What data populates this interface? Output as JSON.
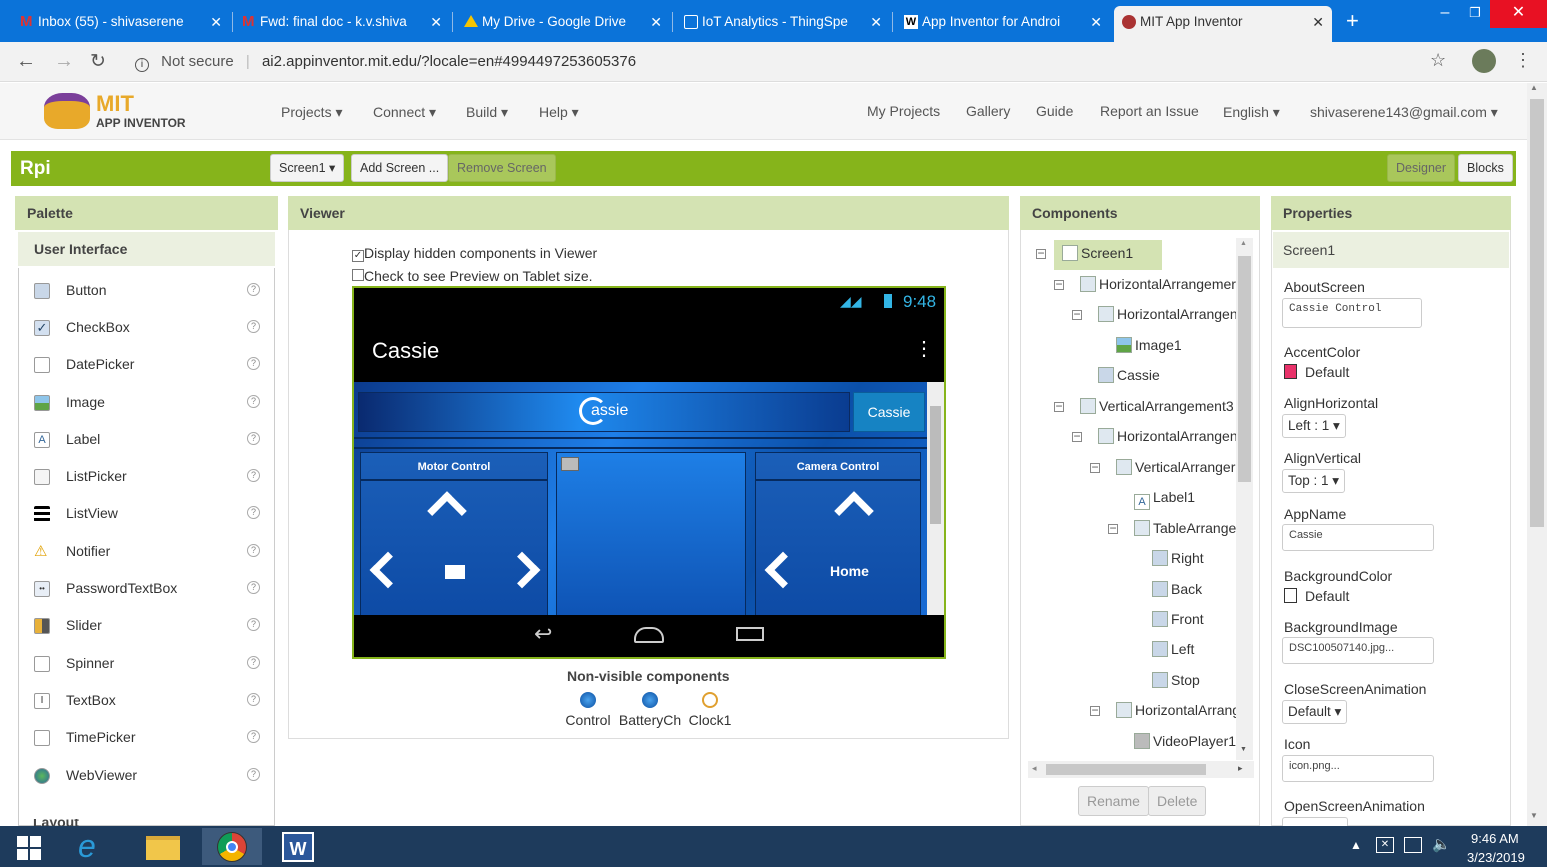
{
  "browser": {
    "tabs": [
      {
        "title": "Inbox (55) - shivaserene",
        "icon": "gmail-icon"
      },
      {
        "title": "Fwd: final doc - k.v.shiva",
        "icon": "gmail-icon"
      },
      {
        "title": "My Drive - Google Drive",
        "icon": "drive-icon"
      },
      {
        "title": "IoT Analytics - ThingSpe",
        "icon": "thingspeak-icon"
      },
      {
        "title": "App Inventor for Androi",
        "icon": "wikipedia-icon"
      },
      {
        "title": "MIT App Inventor",
        "icon": "appinventor-icon"
      }
    ],
    "security": "Not secure",
    "url": "ai2.appinventor.mit.edu/?locale=en#4994497253605376"
  },
  "app": {
    "logo_mit": "MIT",
    "logo_sub": "APP INVENTOR",
    "menus": [
      "Projects ▾",
      "Connect ▾",
      "Build ▾",
      "Help ▾"
    ],
    "right_menus": [
      "My Projects",
      "Gallery",
      "Guide",
      "Report an Issue",
      "English ▾"
    ],
    "account": "shivaserene143@gmail.com ▾"
  },
  "toolbar": {
    "project": "Rpi",
    "screen_select": "Screen1 ▾",
    "add_screen": "Add Screen ...",
    "remove_screen": "Remove Screen",
    "designer": "Designer",
    "blocks": "Blocks"
  },
  "palette": {
    "title": "Palette",
    "section": "User Interface",
    "items": [
      "Button",
      "CheckBox",
      "DatePicker",
      "Image",
      "Label",
      "ListPicker",
      "ListView",
      "Notifier",
      "PasswordTextBox",
      "Slider",
      "Spinner",
      "TextBox",
      "TimePicker",
      "WebViewer"
    ],
    "next_section": "Layout"
  },
  "viewer": {
    "title": "Viewer",
    "chk_hidden": "Display hidden components in Viewer",
    "chk_tablet": "Check to see Preview on Tablet size.",
    "phone_time": "9:48",
    "app_title": "Cassie",
    "banner_logo": "assie",
    "banner_button": "Cassie",
    "motor_label": "Motor Control",
    "camera_label": "Camera Control",
    "home_label": "Home",
    "nonvisible_title": "Non-visible components",
    "nonvisible": [
      "Control",
      "BatteryCh",
      "Clock1"
    ]
  },
  "components": {
    "title": "Components",
    "tree": [
      {
        "name": "Screen1",
        "depth": 0
      },
      {
        "name": "HorizontalArrangemer",
        "depth": 1
      },
      {
        "name": "HorizontalArrangen",
        "depth": 2
      },
      {
        "name": "Image1",
        "depth": 3
      },
      {
        "name": "Cassie",
        "depth": 2
      },
      {
        "name": "VerticalArrangement3",
        "depth": 1
      },
      {
        "name": "HorizontalArrangen",
        "depth": 2
      },
      {
        "name": "VerticalArranger",
        "depth": 3
      },
      {
        "name": "Label1",
        "depth": 4
      },
      {
        "name": "TableArrange",
        "depth": 4
      },
      {
        "name": "Right",
        "depth": 5
      },
      {
        "name": "Back",
        "depth": 5
      },
      {
        "name": "Front",
        "depth": 5
      },
      {
        "name": "Left",
        "depth": 5
      },
      {
        "name": "Stop",
        "depth": 5
      },
      {
        "name": "HorizontalArrang",
        "depth": 3
      },
      {
        "name": "VideoPlayer1",
        "depth": 4
      }
    ],
    "rename": "Rename",
    "delete": "Delete"
  },
  "properties": {
    "title": "Properties",
    "screen": "Screen1",
    "about_label": "AboutScreen",
    "about_value": "Cassie Control",
    "accent_label": "AccentColor",
    "accent_value": "Default",
    "accent_color": "#e8326a",
    "alignh_label": "AlignHorizontal",
    "alignh_value": "Left : 1 ▾",
    "alignv_label": "AlignVertical",
    "alignv_value": "Top : 1 ▾",
    "appname_label": "AppName",
    "appname_value": "Cassie",
    "bgcolor_label": "BackgroundColor",
    "bgcolor_value": "Default",
    "bgimage_label": "BackgroundImage",
    "bgimage_value": "DSC100507140.jpg...",
    "close_label": "CloseScreenAnimation",
    "close_value": "Default ▾",
    "icon_label": "Icon",
    "icon_value": "icon.png...",
    "open_label": "OpenScreenAnimation"
  },
  "taskbar": {
    "time": "9:46 AM",
    "date": "3/23/2019"
  }
}
